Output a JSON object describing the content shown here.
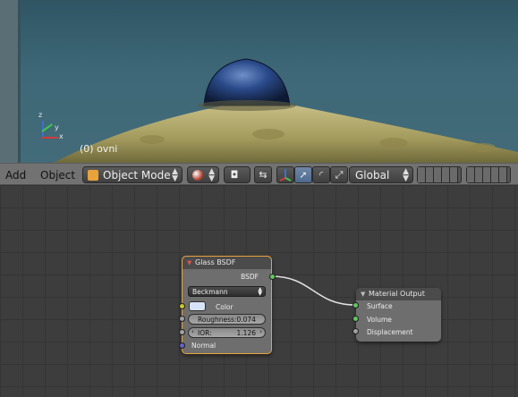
{
  "viewport": {
    "object_label": "(0) ovni",
    "axis_labels": {
      "x": "x",
      "y": "y",
      "z": "z"
    }
  },
  "header": {
    "menu_add": "Add",
    "menu_object": "Object",
    "mode": "Object Mode",
    "orientation": "Global"
  },
  "nodes": {
    "glass": {
      "title": "Glass BSDF",
      "output": "BSDF",
      "distribution": "Beckmann",
      "color_label": "Color",
      "roughness": "Roughness:0.074",
      "ior_label": "IOR:",
      "ior_value": "1.126",
      "normal_label": "Normal"
    },
    "output": {
      "title": "Material Output",
      "inputs": [
        "Surface",
        "Volume",
        "Displacement"
      ]
    }
  },
  "colors": {
    "accent": "#e9a33b",
    "socket_shader": "#62c562",
    "socket_color": "#c7c729",
    "socket_value": "#a1a1a1",
    "socket_vector": "#6363c7"
  }
}
